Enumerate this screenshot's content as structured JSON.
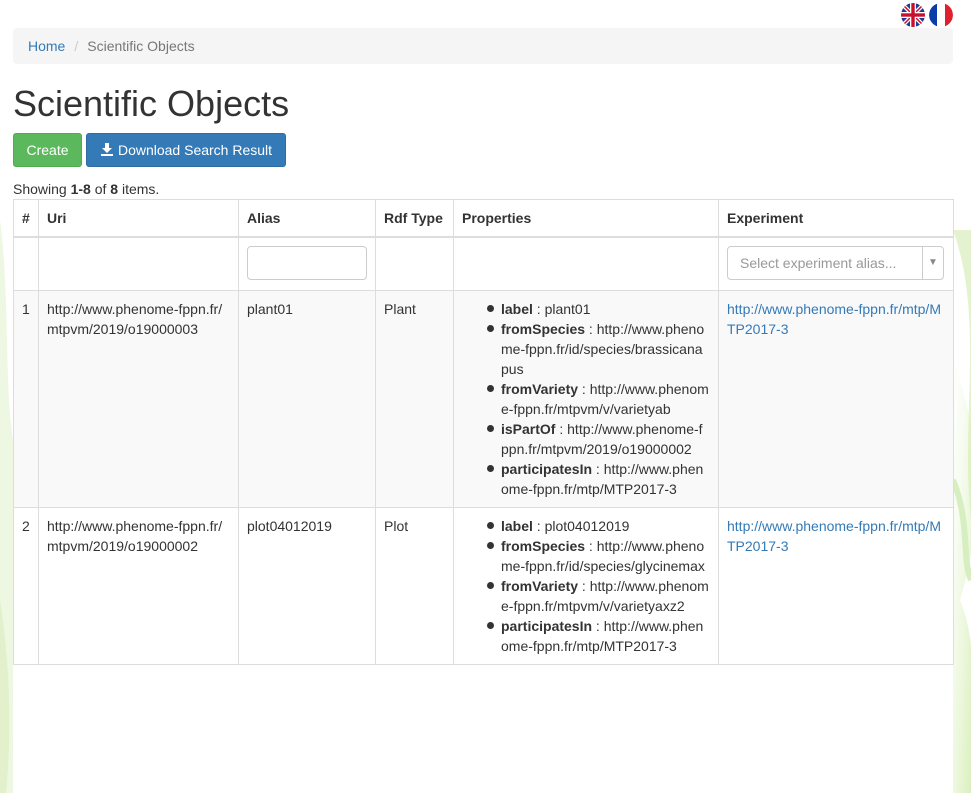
{
  "languages": [
    {
      "name": "English",
      "icon": "uk-flag-icon"
    },
    {
      "name": "Français",
      "icon": "france-flag-icon"
    }
  ],
  "breadcrumb": {
    "home": "Home",
    "current": "Scientific Objects"
  },
  "page_title": "Scientific Objects",
  "buttons": {
    "create": "Create",
    "download": "Download Search Result"
  },
  "summary": {
    "prefix": "Showing ",
    "range": "1-8",
    "middle": " of ",
    "total": "8",
    "suffix": " items."
  },
  "table": {
    "headers": [
      "#",
      "Uri",
      "Alias",
      "Rdf Type",
      "Properties",
      "Experiment"
    ],
    "filters": {
      "alias_value": "",
      "experiment_placeholder": "Select experiment alias..."
    },
    "rows": [
      {
        "num": "1",
        "uri": "http://www.phenome-fppn.fr/mtpvm/2019/o19000003",
        "alias": "plant01",
        "rdf_type": "Plant",
        "properties": [
          {
            "key": "label",
            "value": "plant01"
          },
          {
            "key": "fromSpecies",
            "value": "http://www.phenome-fppn.fr/id/species/brassicanapus"
          },
          {
            "key": "fromVariety",
            "value": "http://www.phenome-fppn.fr/mtpvm/v/varietyab"
          },
          {
            "key": "isPartOf",
            "value": "http://www.phenome-fppn.fr/mtpvm/2019/o19000002"
          },
          {
            "key": "participatesIn",
            "value": "http://www.phenome-fppn.fr/mtp/MTP2017-3"
          }
        ],
        "experiment": "http://www.phenome-fppn.fr/mtp/MTP2017-3"
      },
      {
        "num": "2",
        "uri": "http://www.phenome-fppn.fr/mtpvm/2019/o19000002",
        "alias": "plot04012019",
        "rdf_type": "Plot",
        "properties": [
          {
            "key": "label",
            "value": "plot04012019"
          },
          {
            "key": "fromSpecies",
            "value": "http://www.phenome-fppn.fr/id/species/glycinemax"
          },
          {
            "key": "fromVariety",
            "value": "http://www.phenome-fppn.fr/mtpvm/v/varietyaxz2"
          },
          {
            "key": "participatesIn",
            "value": "http://www.phenome-fppn.fr/mtp/MTP2017-3"
          }
        ],
        "experiment": "http://www.phenome-fppn.fr/mtp/MTP2017-3"
      }
    ]
  },
  "colors": {
    "primary": "#337ab7",
    "success": "#5cb85c",
    "breadcrumb_bg": "#f5f5f5"
  }
}
